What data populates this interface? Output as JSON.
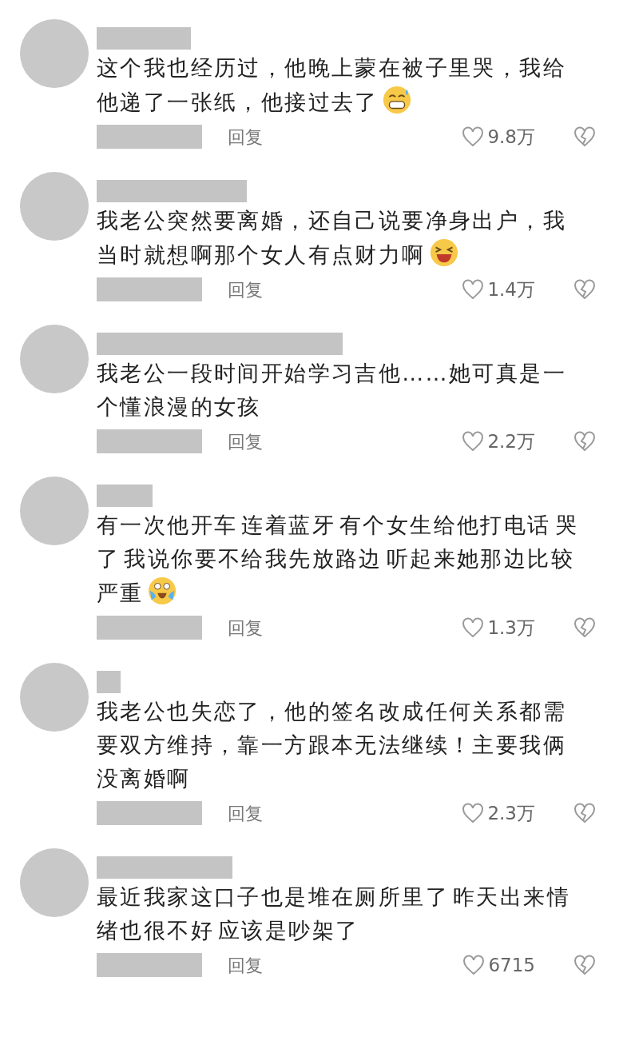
{
  "comments": [
    {
      "text": "这个我也经历过，他晚上蒙在被子里哭，我给他递了一张纸，他接过去了",
      "emoji": {
        "kind": "sweat-grin"
      },
      "reply": "回复",
      "likes": "9.8万"
    },
    {
      "text": "我老公突然要离婚，还自己说要净身出户，我当时就想啊那个女人有点财力啊",
      "emoji": {
        "kind": "laugh"
      },
      "reply": "回复",
      "likes": "1.4万"
    },
    {
      "text": "我老公一段时间开始学习吉他……她可真是一个懂浪漫的女孩",
      "reply": "回复",
      "likes": "2.2万"
    },
    {
      "text": "有一次他开车 连着蓝牙 有个女生给他打电话 哭了 我说你要不给我先放路边 听起来她那边比较严重",
      "emoji": {
        "kind": "cry-laugh"
      },
      "reply": "回复",
      "likes": "1.3万"
    },
    {
      "text": "我老公也失恋了，他的签名改成任何关系都需要双方维持，靠一方跟本无法继续！主要我俩没离婚啊",
      "reply": "回复",
      "likes": "2.3万"
    },
    {
      "text": "最近我家这口子也是堆在厕所里了 昨天出来情绪也很不好 应该是吵架了",
      "reply": "回复",
      "likes": "6715"
    }
  ]
}
